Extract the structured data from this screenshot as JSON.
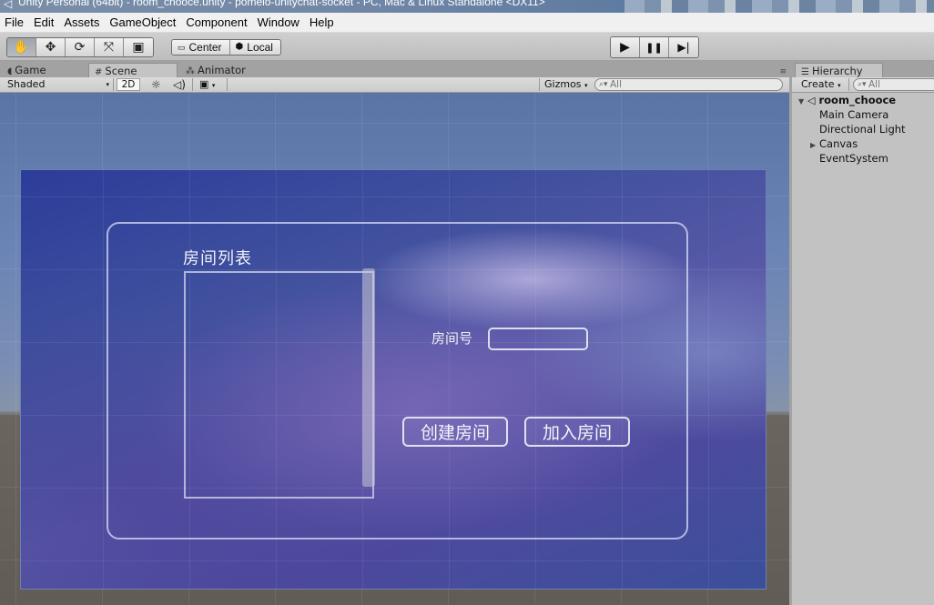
{
  "window": {
    "title": "Unity Personal (64bit) - room_chooce.unity - pomelo-unitychat-socket - PC, Mac & Linux Standalone <DX11>"
  },
  "menu": {
    "items": [
      "File",
      "Edit",
      "Assets",
      "GameObject",
      "Component",
      "Window",
      "Help"
    ]
  },
  "toolbar": {
    "tools": [
      {
        "name": "hand-tool",
        "icon": "hand-icon",
        "glyph": "✋",
        "active": true
      },
      {
        "name": "move-tool",
        "icon": "move-icon",
        "glyph": "✥",
        "active": false
      },
      {
        "name": "rotate-tool",
        "icon": "rotate-icon",
        "glyph": "⟳",
        "active": false
      },
      {
        "name": "scale-tool",
        "icon": "scale-icon",
        "glyph": "⤧",
        "active": false
      },
      {
        "name": "rect-tool",
        "icon": "rect-icon",
        "glyph": "▣",
        "active": false
      }
    ],
    "pivot_label": "Center",
    "pivot_rotation_label": "Local",
    "play_glyph": "▶",
    "pause_glyph": "❚❚",
    "step_glyph": "▶|"
  },
  "scene_tabs": {
    "game": "Game",
    "scene": "Scene",
    "animator": "Animator"
  },
  "scene_toolbar": {
    "shading_mode": "Shaded",
    "mode_2d": "2D",
    "gizmos": "Gizmos",
    "search_placeholder": "All"
  },
  "game_ui": {
    "room_list_title": "房间列表",
    "room_number_label": "房间号",
    "room_number_value": "",
    "create_room_button": "创建房间",
    "join_room_button": "加入房间"
  },
  "hierarchy": {
    "tab_label": "Hierarchy",
    "create_label": "Create",
    "search_placeholder": "All",
    "scene_name": "room_chooce",
    "items": [
      {
        "label": "Main Camera",
        "expandable": false
      },
      {
        "label": "Directional Light",
        "expandable": false
      },
      {
        "label": "Canvas",
        "expandable": true
      },
      {
        "label": "EventSystem",
        "expandable": false
      }
    ]
  },
  "colors": {
    "canvas_bg": "#3f4fa0",
    "ui_border": "#e6e8f5",
    "editor_bg": "#c2c2c2"
  }
}
